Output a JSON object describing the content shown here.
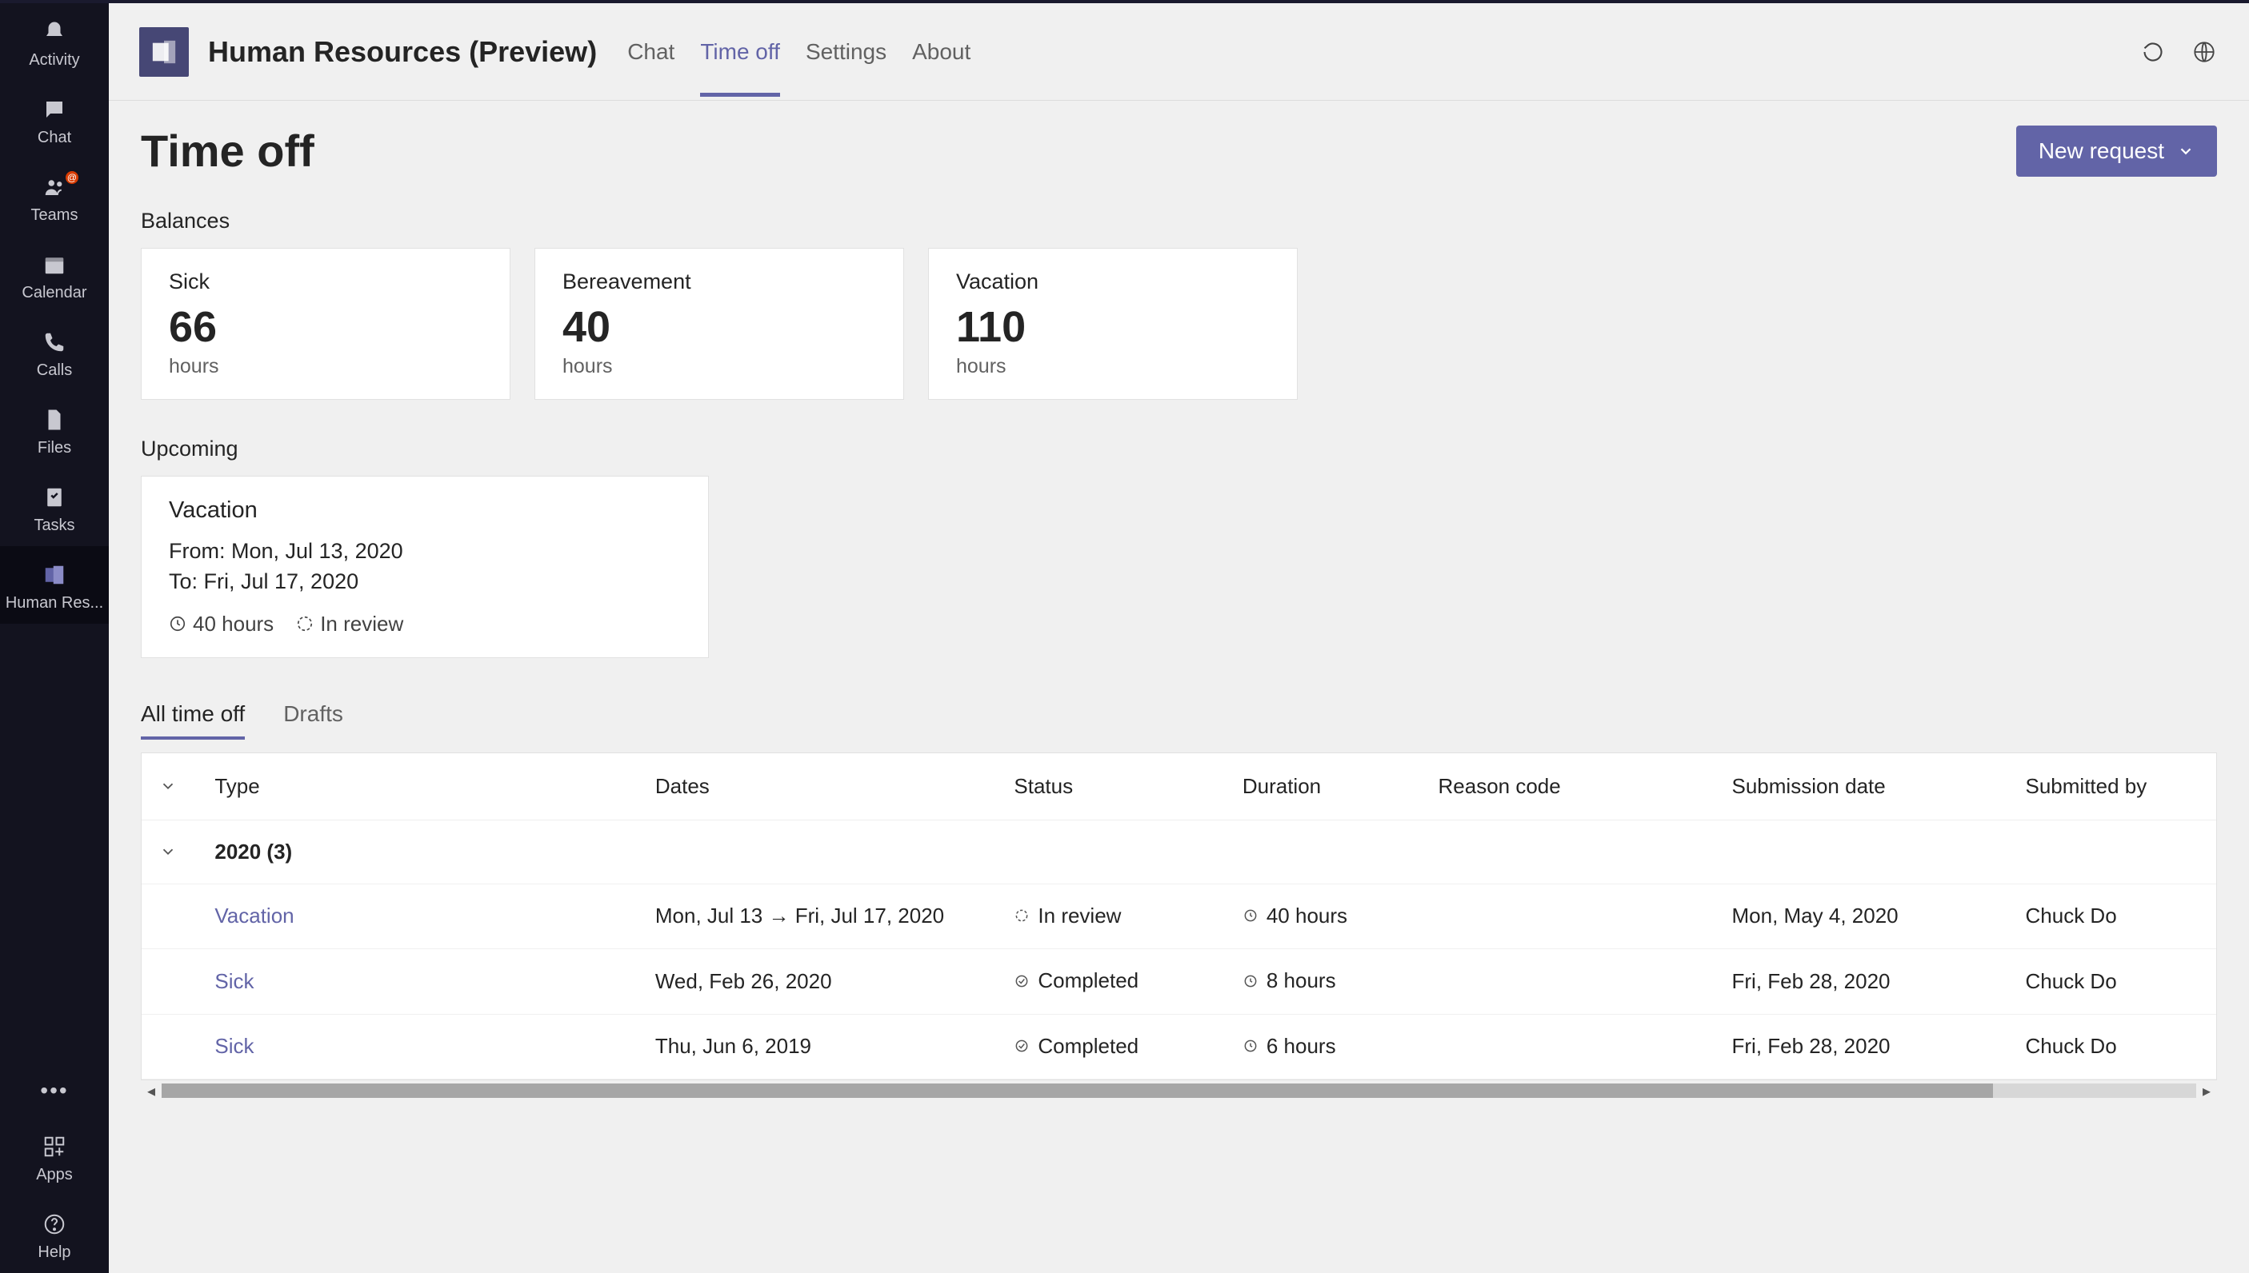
{
  "rail": {
    "items": [
      {
        "label": "Activity",
        "icon": "bell"
      },
      {
        "label": "Chat",
        "icon": "chat"
      },
      {
        "label": "Teams",
        "icon": "teams",
        "badge": "@"
      },
      {
        "label": "Calendar",
        "icon": "calendar"
      },
      {
        "label": "Calls",
        "icon": "calls"
      },
      {
        "label": "Files",
        "icon": "files"
      },
      {
        "label": "Tasks",
        "icon": "tasks"
      },
      {
        "label": "Human Res...",
        "icon": "hr",
        "active": true
      }
    ],
    "bottom": [
      {
        "label": "Apps",
        "icon": "apps"
      },
      {
        "label": "Help",
        "icon": "help"
      }
    ]
  },
  "header": {
    "app_title": "Human Resources (Preview)",
    "tabs": [
      {
        "label": "Chat"
      },
      {
        "label": "Time off",
        "active": true
      },
      {
        "label": "Settings"
      },
      {
        "label": "About"
      }
    ]
  },
  "page": {
    "title": "Time off",
    "new_request": "New request"
  },
  "balances": {
    "title": "Balances",
    "items": [
      {
        "type": "Sick",
        "value": "66",
        "unit": "hours"
      },
      {
        "type": "Bereavement",
        "value": "40",
        "unit": "hours"
      },
      {
        "type": "Vacation",
        "value": "110",
        "unit": "hours"
      }
    ]
  },
  "upcoming": {
    "title": "Upcoming",
    "card": {
      "title": "Vacation",
      "from": "From: Mon, Jul 13, 2020",
      "to": "To: Fri, Jul 17, 2020",
      "duration": "40 hours",
      "status": "In review"
    }
  },
  "subtabs": [
    {
      "label": "All time off",
      "active": true
    },
    {
      "label": "Drafts"
    }
  ],
  "table": {
    "columns": [
      "Type",
      "Dates",
      "Status",
      "Duration",
      "Reason code",
      "Submission date",
      "Submitted by"
    ],
    "group": "2020 (3)",
    "rows": [
      {
        "type": "Vacation",
        "dates": "Mon, Jul 13 → Fri, Jul 17, 2020",
        "status": "In review",
        "status_icon": "review",
        "duration": "40 hours",
        "reason": "",
        "sub_date": "Mon, May 4, 2020",
        "sub_by": "Chuck Do"
      },
      {
        "type": "Sick",
        "dates": "Wed, Feb 26, 2020",
        "status": "Completed",
        "status_icon": "completed",
        "duration": "8 hours",
        "reason": "",
        "sub_date": "Fri, Feb 28, 2020",
        "sub_by": "Chuck Do"
      },
      {
        "type": "Sick",
        "dates": "Thu, Jun 6, 2019",
        "status": "Completed",
        "status_icon": "completed",
        "duration": "6 hours",
        "reason": "",
        "sub_date": "Fri, Feb 28, 2020",
        "sub_by": "Chuck Do"
      }
    ]
  }
}
